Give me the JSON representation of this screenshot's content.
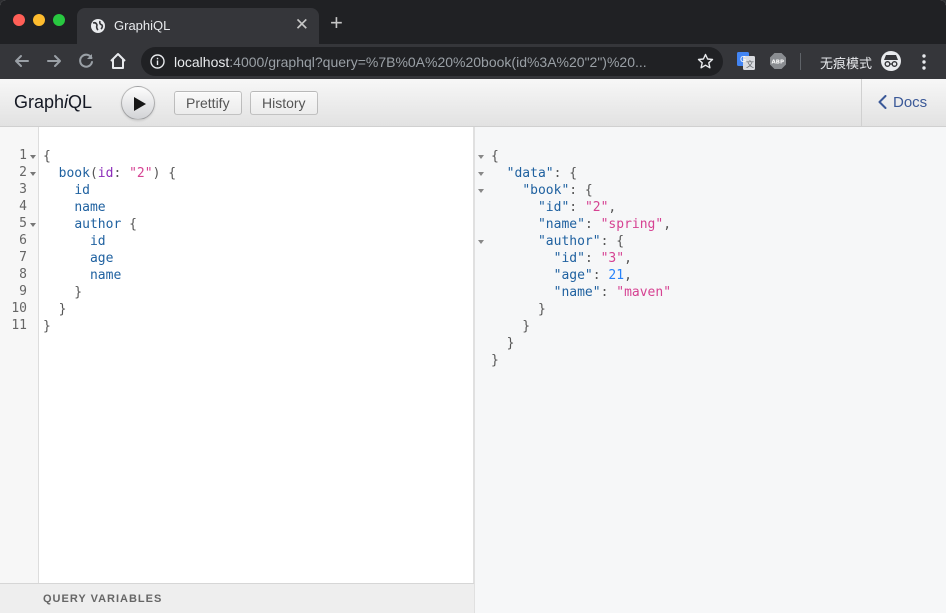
{
  "browser": {
    "tab_title": "GraphiQL",
    "url_host": "localhost",
    "url_rest": ":4000/graphql?query=%7B%0A%20%20book(id%3A%20\"2\")%20...",
    "incognito_label": "无痕模式"
  },
  "graphiql": {
    "title_prefix": "Graph",
    "title_italic": "i",
    "title_suffix": "QL",
    "prettify_label": "Prettify",
    "history_label": "History",
    "docs_label": "Docs",
    "query_variables_label": "QUERY VARIABLES"
  },
  "query_editor": {
    "line_numbers": [
      "1",
      "2",
      "3",
      "4",
      "5",
      "6",
      "7",
      "8",
      "9",
      "10",
      "11"
    ],
    "lines": [
      "{",
      "  book(id: \"2\") {",
      "    id",
      "    name",
      "    author {",
      "      id",
      "      age",
      "      name",
      "    }",
      "  }",
      "}"
    ]
  },
  "result": {
    "lines": [
      "{",
      "  \"data\": {",
      "    \"book\": {",
      "      \"id\": \"2\",",
      "      \"name\": \"spring\",",
      "      \"author\": {",
      "        \"id\": \"3\",",
      "        \"age\": 21,",
      "        \"name\": \"maven\"",
      "      }",
      "    }",
      "  }",
      "}"
    ],
    "values": {
      "book_id": "2",
      "book_name": "spring",
      "author_id": "3",
      "author_age": 21,
      "author_name": "maven"
    }
  },
  "colors": {
    "field": "#1f61a0",
    "argument": "#8b2bb9",
    "string": "#d64292",
    "number": "#2882f9",
    "docs_link": "#3b5998"
  }
}
